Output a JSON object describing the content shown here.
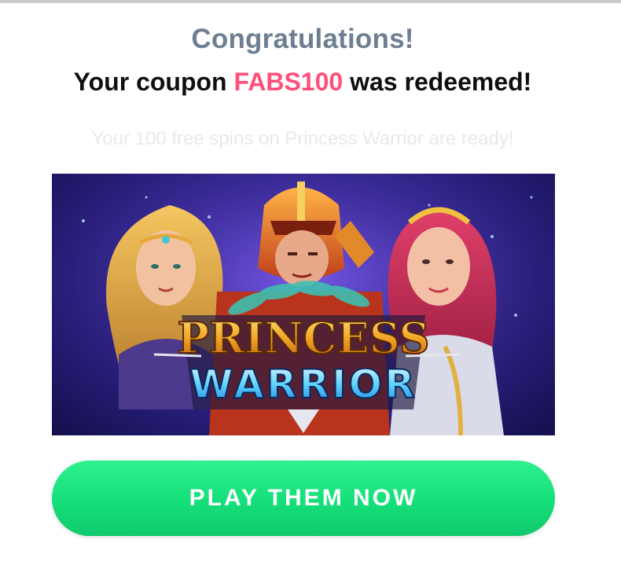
{
  "header": {
    "title": "Congratulations!",
    "message_prefix": "Your coupon ",
    "coupon_code": "FABS100",
    "message_suffix": " was redeemed!"
  },
  "spins": {
    "text": "Your 100 free spins on Princess Warrior are ready!"
  },
  "banner": {
    "game_name_line1": "PRINCESS",
    "game_name_line2": "WARRIOR"
  },
  "cta": {
    "label": "PLAY THEM NOW"
  },
  "colors": {
    "coupon": "#ff4f7a",
    "heading": "#6e7f92",
    "button": "#14df7a"
  }
}
